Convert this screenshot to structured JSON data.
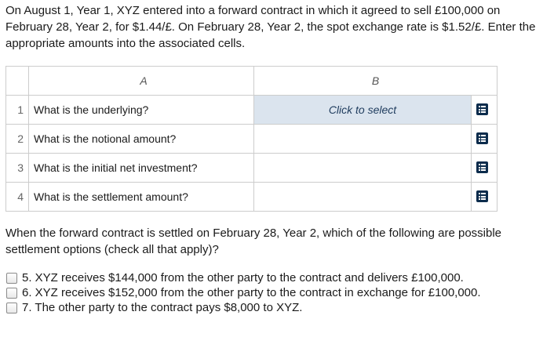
{
  "intro_text": "On August 1, Year 1, XYZ entered into a forward contract in which it agreed to sell £100,000 on February 28, Year 2, for $1.44/£. On February 28, Year 2, the spot exchange rate is $1.52/£. Enter the appropriate amounts into the associated cells.",
  "table": {
    "col_a_header": "A",
    "col_b_header": "B",
    "rows": [
      {
        "num": "1",
        "question": "What is the underlying?",
        "answer": "Click to select"
      },
      {
        "num": "2",
        "question": "What is the notional amount?",
        "answer": ""
      },
      {
        "num": "3",
        "question": "What is the initial net investment?",
        "answer": ""
      },
      {
        "num": "4",
        "question": "What is the settlement amount?",
        "answer": ""
      }
    ],
    "icon": "list-select-icon"
  },
  "question2": "When the forward contract is settled on February 28, Year 2, which of the following are possible settlement options (check all that apply)?",
  "options": [
    "5. XYZ receives $144,000 from the other party to the contract and delivers £100,000.",
    "6. XYZ receives $152,000 from the other party to the contract in exchange for £100,000.",
    "7. The other party to the contract pays $8,000 to XYZ."
  ],
  "colors": {
    "selected_cell": "#dbe4ee",
    "icon": "#0c2c4c"
  }
}
